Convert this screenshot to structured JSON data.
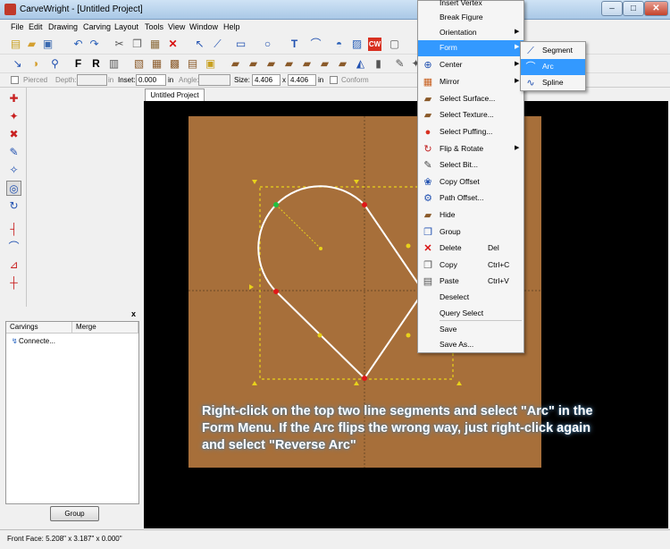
{
  "window": {
    "title": "CarveWright - [Untitled Project]",
    "min": "–",
    "max": "□",
    "close": "✕"
  },
  "menubar": [
    "File",
    "Edit",
    "Drawing",
    "Carving",
    "Layout",
    "Tools",
    "View",
    "Window",
    "Help"
  ],
  "options_bar": {
    "pierced_label": "Pierced",
    "depth_label": "Depth:",
    "depth_unit": "in",
    "inset_label": "Inset:",
    "inset_value": "0.000",
    "inset_unit": "in",
    "angle_label": "Angle:",
    "size_label": "Size:",
    "size_w": "4.406",
    "size_x": "x",
    "size_h": "4.406",
    "size_unit": "in",
    "conform_label": "Conform"
  },
  "document_tab": "Untitled Project",
  "carvings_panel": {
    "close": "x",
    "columns": [
      "Carvings",
      "Merge"
    ],
    "row": "Connecte...",
    "group_button": "Group"
  },
  "context_menu": {
    "items": [
      {
        "label": "Insert Vertex",
        "icon": "vertex-icon",
        "shortcut": "",
        "submenu": false
      },
      {
        "label": "Break Figure",
        "icon": "break-figure-icon",
        "shortcut": "",
        "submenu": false
      },
      {
        "label": "Orientation",
        "icon": "orientation-icon",
        "shortcut": "",
        "submenu": true
      },
      {
        "label": "Form",
        "icon": "form-icon",
        "shortcut": "",
        "submenu": true,
        "highlighted": true
      },
      {
        "label": "Center",
        "icon": "center-icon",
        "shortcut": "",
        "submenu": true
      },
      {
        "label": "Mirror",
        "icon": "mirror-icon",
        "shortcut": "",
        "submenu": true
      },
      {
        "label": "Select Surface...",
        "icon": "surface-icon",
        "shortcut": "",
        "submenu": false
      },
      {
        "label": "Select Texture...",
        "icon": "texture-icon",
        "shortcut": "",
        "submenu": false
      },
      {
        "label": "Select Puffing...",
        "icon": "puffing-icon",
        "shortcut": "",
        "submenu": false
      },
      {
        "label": "Flip & Rotate",
        "icon": "flip-rotate-icon",
        "shortcut": "",
        "submenu": true
      },
      {
        "label": "Select Bit...",
        "icon": "bit-icon",
        "shortcut": "",
        "submenu": false
      },
      {
        "label": "Copy Offset",
        "icon": "copy-offset-icon",
        "shortcut": "",
        "submenu": false
      },
      {
        "label": "Path Offset...",
        "icon": "path-offset-icon",
        "shortcut": "",
        "submenu": false
      },
      {
        "label": "Hide",
        "icon": "hide-icon",
        "shortcut": "",
        "submenu": false
      },
      {
        "label": "Group",
        "icon": "group-icon",
        "shortcut": "",
        "submenu": false
      },
      {
        "label": "Delete",
        "icon": "delete-icon",
        "shortcut": "Del",
        "submenu": false
      },
      {
        "label": "Copy",
        "icon": "copy-icon",
        "shortcut": "Ctrl+C",
        "submenu": false
      },
      {
        "label": "Paste",
        "icon": "paste-icon",
        "shortcut": "Ctrl+V",
        "submenu": false
      },
      {
        "label": "Deselect",
        "icon": "",
        "shortcut": "",
        "submenu": false
      },
      {
        "label": "Query Select",
        "icon": "",
        "shortcut": "",
        "submenu": false
      },
      {
        "label": "Save",
        "icon": "",
        "shortcut": "",
        "submenu": false
      },
      {
        "label": "Save As...",
        "icon": "",
        "shortcut": "",
        "submenu": false
      }
    ]
  },
  "form_submenu": {
    "items": [
      {
        "label": "Segment",
        "icon": "segment-icon"
      },
      {
        "label": "Arc",
        "icon": "arc-icon",
        "highlighted": true
      },
      {
        "label": "Spline",
        "icon": "spline-icon"
      }
    ]
  },
  "instruction": "Right-click on the top two line segments and select \"Arc\" in the Form Menu. If the Arc flips the wrong way, just right-click again and select \"Reverse Arc\"",
  "status_text": "Front Face: 5.208\" x 3.187\" x 0.000\"",
  "colors": {
    "board": "#a76f3a",
    "highlight": "#3399ff",
    "selection_box": "#e8d21a",
    "shape_line": "#ffffff"
  }
}
